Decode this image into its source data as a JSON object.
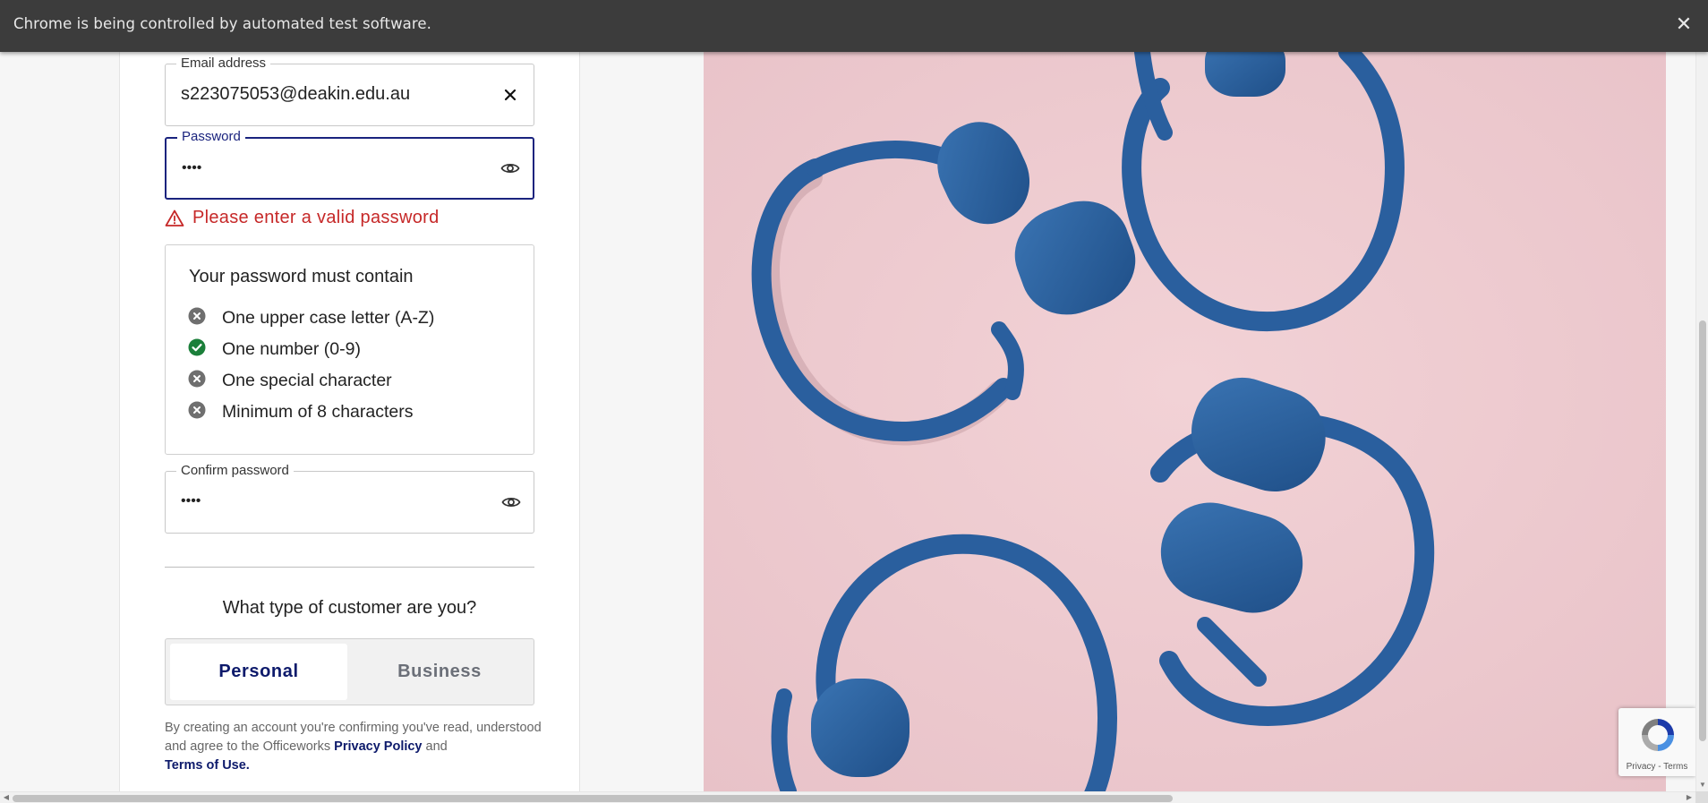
{
  "infobar": {
    "message": "Chrome is being controlled by automated test software.",
    "close_label": "✕"
  },
  "form": {
    "email": {
      "label": "Email address",
      "value": "s223075053@deakin.edu.au",
      "clear_icon": "close-icon"
    },
    "password": {
      "label": "Password",
      "value": "••••",
      "toggle_icon": "eye-icon"
    },
    "error": {
      "message": "Please enter a valid password",
      "icon": "warning-icon",
      "color": "#c62828"
    },
    "rules": {
      "title": "Your password must contain",
      "items": [
        {
          "label": "One upper case letter (A-Z)",
          "status": "unmet"
        },
        {
          "label": "One number (0-9)",
          "status": "met"
        },
        {
          "label": "One special character",
          "status": "unmet"
        },
        {
          "label": "Minimum of 8 characters",
          "status": "unmet"
        }
      ]
    },
    "confirm_password": {
      "label": "Confirm password",
      "value": "••••",
      "toggle_icon": "eye-icon"
    },
    "customer_type": {
      "question": "What type of customer are you?",
      "options": [
        "Personal",
        "Business"
      ],
      "selected": "Personal"
    },
    "legal": {
      "prefix": "By creating an account you're confirming you've read, understood and agree to the Officeworks",
      "privacy_link": "Privacy Policy",
      "conjunction": "and",
      "terms_link": "Terms of Use."
    }
  },
  "recaptcha": {
    "links": "Privacy - Terms"
  },
  "colors": {
    "brand_navy": "#0d1a6b",
    "focus_border": "#1a237e",
    "success_green": "#1b7f3a",
    "unmet_grey": "#6f6f6f",
    "image_bg": "#eecbd0",
    "headphone_blue": "#2a5f9e"
  }
}
